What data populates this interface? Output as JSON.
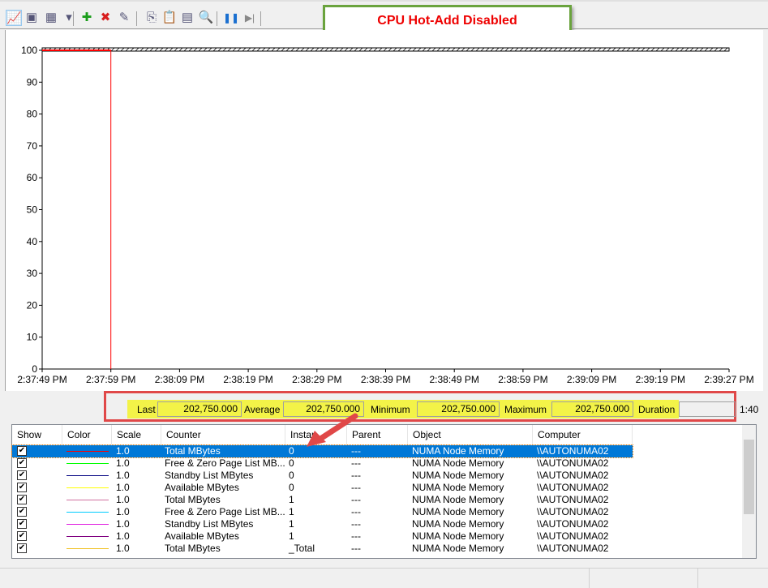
{
  "toolbar": {
    "items": [
      {
        "name": "view-graph-icon",
        "glyph": "📈"
      },
      {
        "name": "view-histogram-icon",
        "glyph": "▣"
      },
      {
        "name": "change-graph-type-icon",
        "glyph": "▦"
      },
      {
        "name": "dropdown-arrow-icon",
        "glyph": "▾"
      },
      {
        "name": "add-counter-icon",
        "glyph": "✚"
      },
      {
        "name": "delete-counter-icon",
        "glyph": "✖"
      },
      {
        "name": "highlight-icon",
        "glyph": "✎"
      },
      {
        "name": "copy-properties-icon",
        "glyph": "⎘"
      },
      {
        "name": "paste-counter-list-icon",
        "glyph": "📋"
      },
      {
        "name": "properties-icon",
        "glyph": "▤"
      },
      {
        "name": "zoom-icon",
        "glyph": "🔍"
      },
      {
        "name": "freeze-display-icon",
        "glyph": "❚❚"
      },
      {
        "name": "update-data-icon",
        "glyph": "▶|"
      }
    ]
  },
  "banner": "CPU Hot-Add Disabled",
  "chart_data": {
    "type": "line",
    "ylim": [
      0,
      100
    ],
    "yticks": [
      "100",
      "90",
      "80",
      "70",
      "60",
      "50",
      "40",
      "30",
      "20",
      "10",
      "0"
    ],
    "xticks": [
      "2:37:49 PM",
      "2:37:59 PM",
      "2:38:09 PM",
      "2:38:19 PM",
      "2:38:29 PM",
      "2:38:39 PM",
      "2:38:49 PM",
      "2:38:59 PM",
      "2:39:09 PM",
      "2:39:19 PM",
      "2:39:27 PM"
    ],
    "note_clipped": "values exceed scale; drawn clipped at 100",
    "series": [
      {
        "name": "Total MBytes",
        "color": "#ff0000",
        "x_start": "2:37:49 PM",
        "x_end": "2:37:59 PM",
        "value": 100
      }
    ],
    "time_cursor": "2:37:59 PM",
    "grid": false
  },
  "stats": {
    "last_label": "Last",
    "last": "202,750.000",
    "avg_label": "Average",
    "avg": "202,750.000",
    "min_label": "Minimum",
    "min": "202,750.000",
    "max_label": "Maximum",
    "max": "202,750.000",
    "dur_label": "Duration",
    "dur": "1:40"
  },
  "columns": [
    "Show",
    "Color",
    "Scale",
    "Counter",
    "Instan",
    "Parent",
    "Object",
    "Computer"
  ],
  "rows": [
    {
      "color": "#ff0000",
      "scale": "1.0",
      "counter": "Total MBytes",
      "instance": "0",
      "parent": "---",
      "object": "NUMA Node Memory",
      "computer": "\\\\AUTONUMA02"
    },
    {
      "color": "#00ff00",
      "scale": "1.0",
      "counter": "Free & Zero Page List MB...",
      "instance": "0",
      "parent": "---",
      "object": "NUMA Node Memory",
      "computer": "\\\\AUTONUMA02"
    },
    {
      "color": "#000080",
      "scale": "1.0",
      "counter": "Standby List MBytes",
      "instance": "0",
      "parent": "---",
      "object": "NUMA Node Memory",
      "computer": "\\\\AUTONUMA02"
    },
    {
      "color": "#ffff00",
      "scale": "1.0",
      "counter": "Available MBytes",
      "instance": "0",
      "parent": "---",
      "object": "NUMA Node Memory",
      "computer": "\\\\AUTONUMA02"
    },
    {
      "color": "#d070a0",
      "scale": "1.0",
      "counter": "Total MBytes",
      "instance": "1",
      "parent": "---",
      "object": "NUMA Node Memory",
      "computer": "\\\\AUTONUMA02"
    },
    {
      "color": "#00ccff",
      "scale": "1.0",
      "counter": "Free & Zero Page List MB...",
      "instance": "1",
      "parent": "---",
      "object": "NUMA Node Memory",
      "computer": "\\\\AUTONUMA02"
    },
    {
      "color": "#e020e0",
      "scale": "1.0",
      "counter": "Standby List MBytes",
      "instance": "1",
      "parent": "---",
      "object": "NUMA Node Memory",
      "computer": "\\\\AUTONUMA02"
    },
    {
      "color": "#800080",
      "scale": "1.0",
      "counter": "Available MBytes",
      "instance": "1",
      "parent": "---",
      "object": "NUMA Node Memory",
      "computer": "\\\\AUTONUMA02"
    },
    {
      "color": "#f0c020",
      "scale": "1.0",
      "counter": "Total MBytes",
      "instance": "_Total",
      "parent": "---",
      "object": "NUMA Node Memory",
      "computer": "\\\\AUTONUMA02"
    }
  ]
}
